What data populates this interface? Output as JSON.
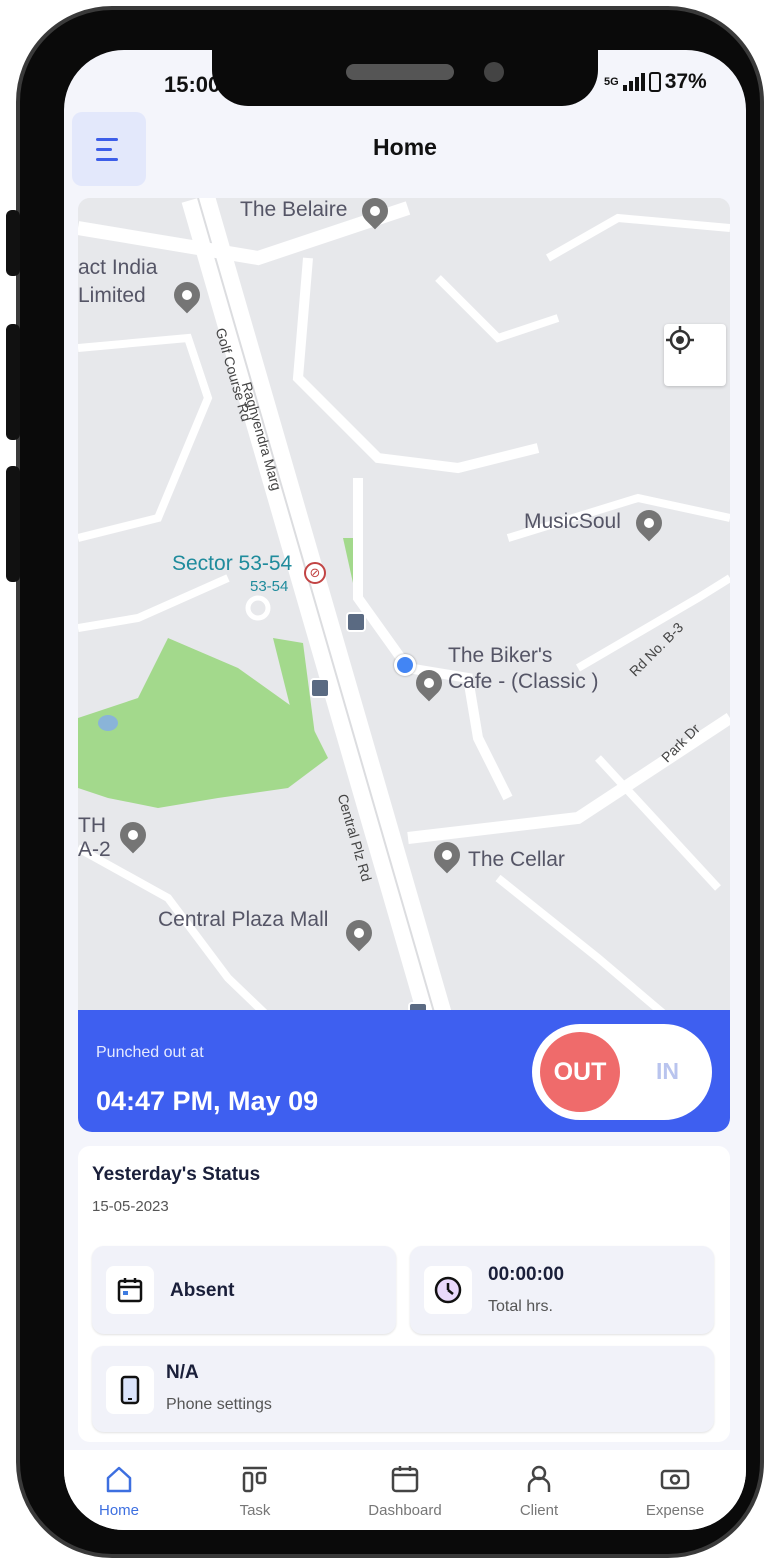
{
  "status_bar": {
    "time": "15:00",
    "network": "5G",
    "battery": "37%"
  },
  "header": {
    "title": "Home"
  },
  "map": {
    "labels": [
      "The Belaire",
      "act India",
      "Limited",
      "Golf Course Rd",
      "Raghvendra Marg",
      "Sector 53-54",
      "53-54",
      "MusicSoul",
      "The Biker's",
      "Cafe - (Classic )",
      "Rd No. B-3",
      "Park Dr",
      "TH",
      "A-2",
      "The Cellar",
      "Central Plaza Mall",
      "Central Plz Rd"
    ]
  },
  "punch": {
    "label": "Punched out at",
    "time": "04:47 PM,  May 09",
    "out_label": "OUT",
    "in_label": "IN"
  },
  "status": {
    "title": "Yesterday's Status",
    "date": "15-05-2023",
    "attendance": "Absent",
    "hours_value": "00:00:00",
    "hours_label": "Total hrs.",
    "phone_value": "N/A",
    "phone_label": "Phone settings"
  },
  "nav": {
    "items": [
      "Home",
      "Task",
      "Dashboard",
      "Client",
      "Expense"
    ]
  },
  "colors": {
    "accent": "#3e5ff0",
    "out": "#ef6b6b",
    "park": "#a3d98c"
  }
}
